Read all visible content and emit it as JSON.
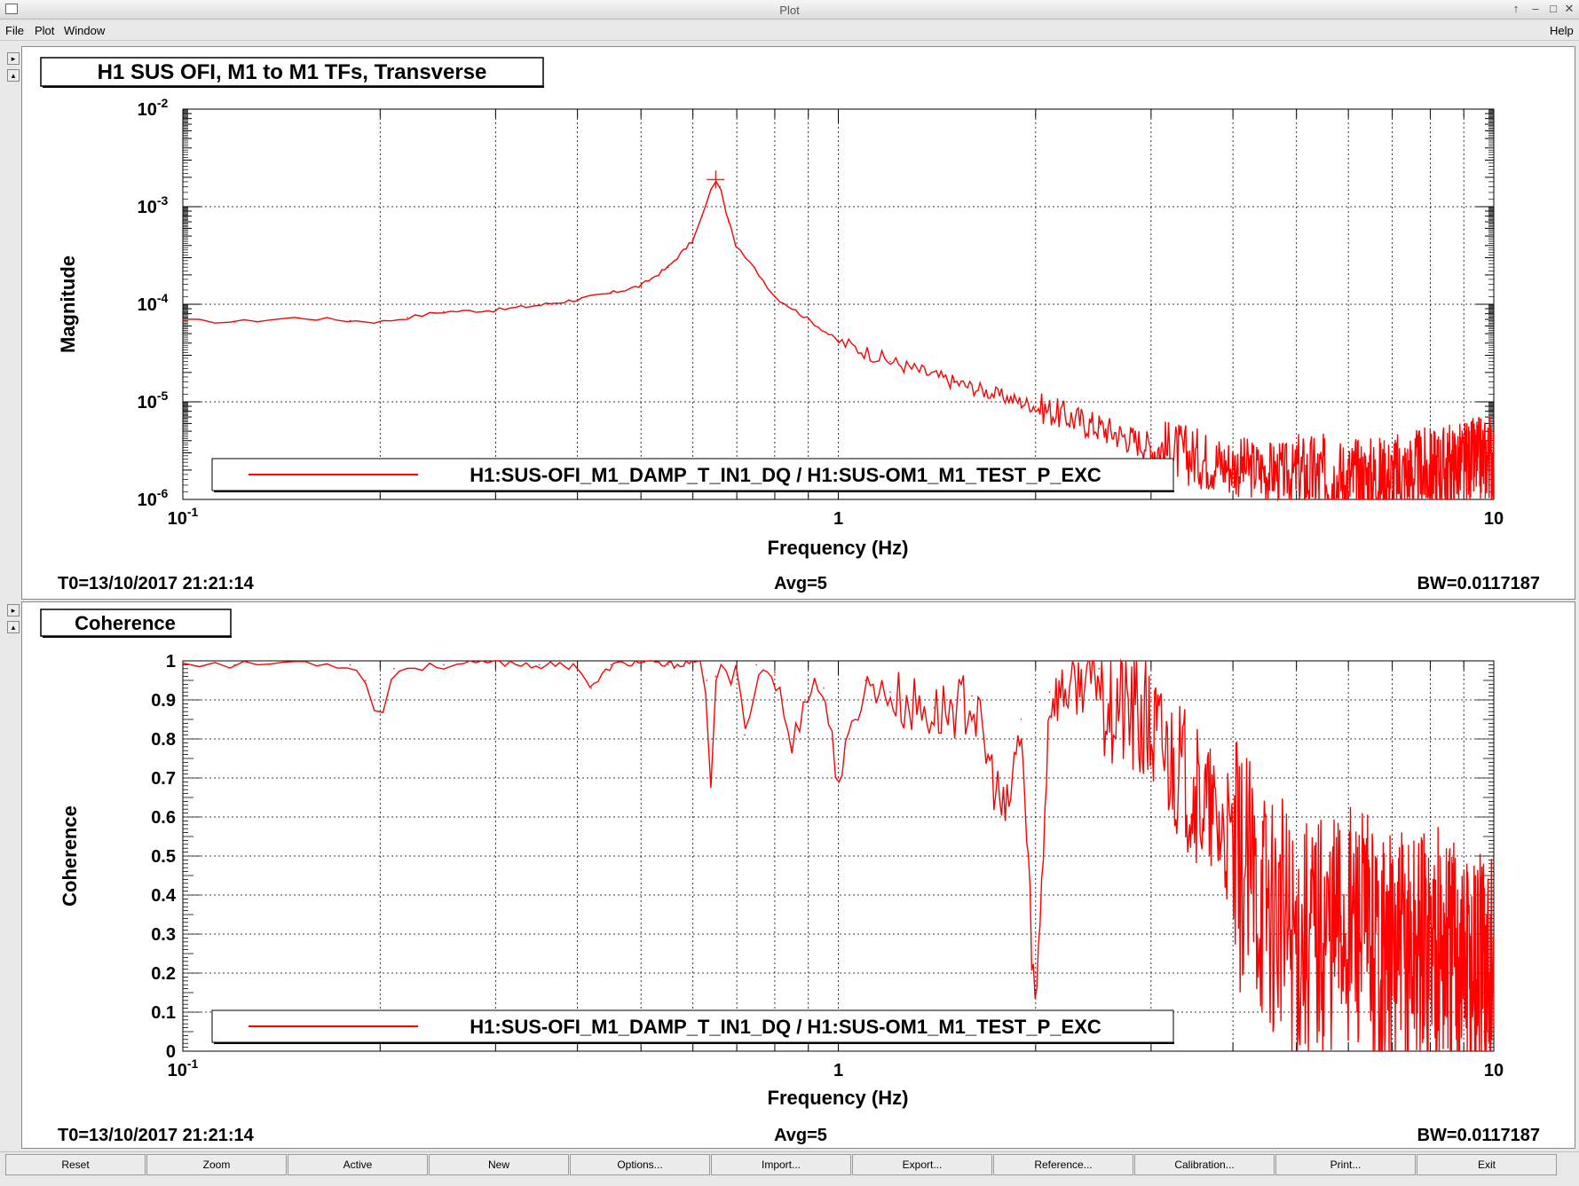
{
  "window": {
    "title": "Plot",
    "controls": [
      "↑",
      "–",
      "□",
      "✕"
    ]
  },
  "menu": {
    "items": [
      {
        "label": "File"
      },
      {
        "label": "Plot"
      },
      {
        "label": "Window"
      },
      {
        "label": "Help"
      }
    ]
  },
  "pane_arrows": {
    "up": "▸",
    "down": "▴"
  },
  "colors": {
    "trace": "#ff0000",
    "grid": "#000000",
    "background": "#ffffff"
  },
  "bottom_buttons": [
    "Reset",
    "Zoom",
    "Active",
    "New",
    "Options...",
    "Import...",
    "Export...",
    "Reference...",
    "Calibration...",
    "Print...",
    "Exit"
  ],
  "chart_data": [
    {
      "type": "line",
      "title": "H1 SUS OFI, M1 to M1 TFs, Transverse",
      "xlabel": "Frequency (Hz)",
      "ylabel": "Magnitude",
      "xscale": "log",
      "yscale": "log",
      "xlim": [
        0.1,
        10
      ],
      "ylim": [
        1e-06,
        0.01
      ],
      "x_tick_labels": [
        {
          "base": "10",
          "exp": "-1"
        },
        {
          "base": "1",
          "exp": ""
        },
        {
          "base": "10",
          "exp": ""
        }
      ],
      "y_tick_labels": [
        {
          "base": "10",
          "exp": "-2"
        },
        {
          "base": "10",
          "exp": "-3"
        },
        {
          "base": "10",
          "exp": "-4"
        },
        {
          "base": "10",
          "exp": "-5"
        },
        {
          "base": "10",
          "exp": "-6"
        }
      ],
      "grid": true,
      "legend_location": "bottom",
      "series": [
        {
          "name": "H1:SUS-OFI_M1_DAMP_T_IN1_DQ / H1:SUS-OM1_M1_TEST_P_EXC",
          "x": [
            0.1,
            0.12,
            0.15,
            0.18,
            0.2,
            0.22,
            0.25,
            0.3,
            0.35,
            0.4,
            0.45,
            0.5,
            0.55,
            0.6,
            0.62,
            0.64,
            0.65,
            0.66,
            0.68,
            0.7,
            0.75,
            0.8,
            0.9,
            1.0,
            1.2,
            1.5,
            2.0,
            2.5,
            3.0,
            4.0,
            5.0,
            6.0,
            7.0,
            8.0,
            9.0,
            10.0
          ],
          "y": [
            6.8e-05,
            6.6e-05,
            7.3e-05,
            6.8e-05,
            6.6e-05,
            7.3e-05,
            8.4e-05,
            8.7e-05,
            9.8e-05,
            0.000112,
            0.00013,
            0.000155,
            0.00024,
            0.00045,
            0.0008,
            0.0015,
            0.0019,
            0.0016,
            0.0007,
            0.00038,
            0.00022,
            0.00012,
            7e-05,
            4.2e-05,
            2.6e-05,
            1.6e-05,
            9e-06,
            5.5e-06,
            3.5e-06,
            2.2e-06,
            1.8e-06,
            1.6e-06,
            1.7e-06,
            2e-06,
            2.3e-06,
            2.8e-06
          ]
        }
      ],
      "annotations": [
        "T0=13/10/2017 21:21:14",
        "Avg=5",
        "BW=0.0117187"
      ]
    },
    {
      "type": "line",
      "title": "Coherence",
      "xlabel": "Frequency (Hz)",
      "ylabel": "Coherence",
      "xscale": "log",
      "xlim": [
        0.1,
        10
      ],
      "ylim": [
        0,
        1
      ],
      "x_tick_labels": [
        {
          "base": "10",
          "exp": "-1"
        },
        {
          "base": "1",
          "exp": ""
        },
        {
          "base": "10",
          "exp": ""
        }
      ],
      "y_tick_labels": [
        "1",
        "0.9",
        "0.8",
        "0.7",
        "0.6",
        "0.5",
        "0.4",
        "0.3",
        "0.2",
        "0.1",
        "0"
      ],
      "grid": true,
      "legend_location": "bottom",
      "series": [
        {
          "name": "H1:SUS-OFI_M1_DAMP_T_IN1_DQ / H1:SUS-OM1_M1_TEST_P_EXC",
          "x": [
            0.1,
            0.12,
            0.15,
            0.18,
            0.19,
            0.2,
            0.21,
            0.25,
            0.3,
            0.35,
            0.4,
            0.42,
            0.45,
            0.5,
            0.55,
            0.6,
            0.63,
            0.64,
            0.65,
            0.7,
            0.72,
            0.75,
            0.8,
            0.85,
            0.9,
            0.95,
            1.0,
            1.1,
            1.2,
            1.4,
            1.6,
            1.8,
            1.9,
            2.0,
            2.1,
            2.5,
            3.0,
            3.5,
            4.0,
            5.0,
            6.0,
            7.0,
            8.0,
            9.0,
            10.0
          ],
          "y": [
            1.0,
            0.99,
            1.0,
            0.99,
            0.95,
            0.84,
            0.98,
            0.99,
            1.0,
            0.99,
            0.99,
            0.93,
            0.99,
            1.0,
            0.99,
            1.0,
            0.95,
            0.69,
            0.96,
            0.97,
            0.81,
            0.99,
            0.97,
            0.78,
            0.95,
            0.93,
            0.7,
            0.95,
            0.92,
            0.88,
            0.91,
            0.6,
            0.85,
            0.1,
            0.92,
            0.98,
            0.85,
            0.7,
            0.55,
            0.35,
            0.4,
            0.3,
            0.35,
            0.3,
            0.25
          ]
        }
      ],
      "annotations": [
        "T0=13/10/2017 21:21:14",
        "Avg=5",
        "BW=0.0117187"
      ]
    }
  ]
}
